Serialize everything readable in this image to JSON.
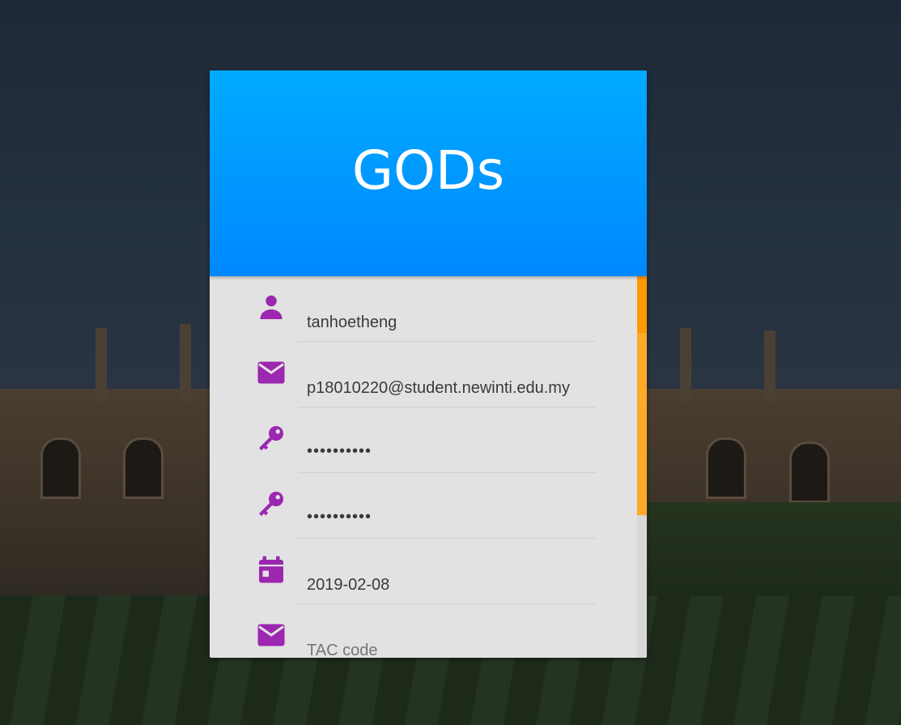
{
  "app": {
    "title": "GODs"
  },
  "form": {
    "username": {
      "icon": "person-icon",
      "value": "tanhoetheng"
    },
    "email": {
      "icon": "email-icon",
      "value": "p18010220@student.newinti.edu.my"
    },
    "password": {
      "icon": "key-icon",
      "value": "••••••••••"
    },
    "confirm_password": {
      "icon": "key-icon",
      "value": "••••••••••"
    },
    "birthdate": {
      "icon": "calendar-icon",
      "value": "2019-02-08"
    },
    "tac": {
      "icon": "email-icon",
      "placeholder": "TAC code"
    }
  },
  "colors": {
    "accent": "#9c27b0",
    "header_top": "#00aaff",
    "header_bottom": "#0088ff",
    "scrollbar": "#ff9900"
  }
}
